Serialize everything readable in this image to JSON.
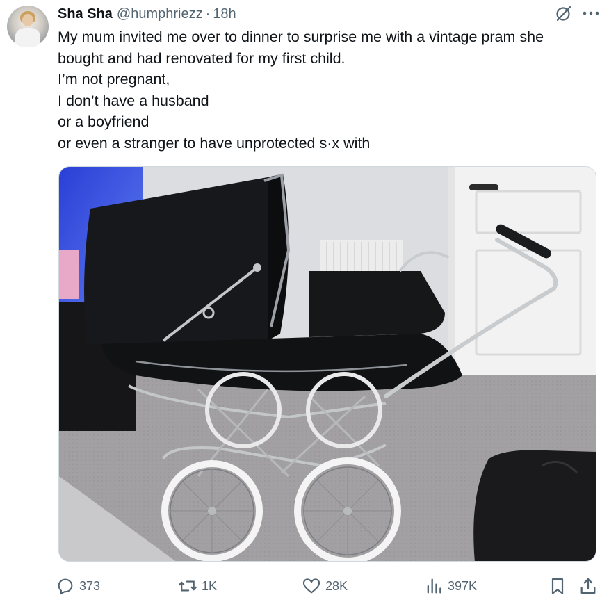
{
  "author": {
    "name": "Sha Sha",
    "handle": "@humphriezz",
    "separator": "·",
    "time": "18h"
  },
  "tweet": {
    "lines": [
      "My mum invited me over to dinner to surprise me with a vintage pram she",
      "bought and had renovated for my first child.",
      "I’m not pregnant,",
      "I don’t have a husband",
      "or a boyfriend",
      "or even a stranger to have unprotected s·x with"
    ]
  },
  "header_icons": [
    "grok-icon",
    "more-icon"
  ],
  "actions": {
    "replies": "373",
    "reposts": "1K",
    "likes": "28K",
    "views": "397K",
    "icons": [
      "reply-icon",
      "repost-icon",
      "like-icon",
      "views-icon",
      "bookmark-icon",
      "share-icon"
    ]
  },
  "colors": {
    "text": "#0f1419",
    "secondary": "#536471",
    "border": "#cfd9de"
  }
}
